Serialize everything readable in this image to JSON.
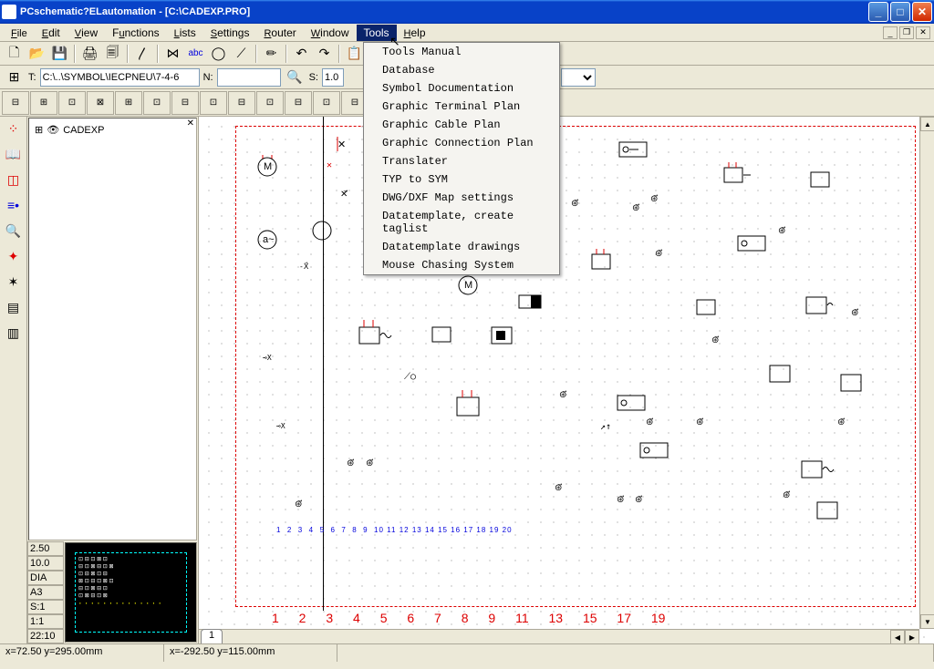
{
  "title": "PCschematic?ELautomation - [C:\\CADEXP.PRO]",
  "menu": {
    "file": "File",
    "edit": "Edit",
    "view": "View",
    "functions": "Functions",
    "lists": "Lists",
    "settings": "Settings",
    "router": "Router",
    "window": "Window",
    "tools": "Tools",
    "help": "Help"
  },
  "tools_menu": [
    "Tools Manual",
    "Database",
    "Symbol Documentation",
    "Graphic Terminal Plan",
    "Graphic Cable Plan",
    "Graphic Connection Plan",
    "Translater",
    "TYP to SYM",
    "DWG/DXF Map settings",
    "Datatemplate, create taglist",
    "Datatemplate drawings",
    "Mouse Chasing System"
  ],
  "toolbar2": {
    "t_label": "T:",
    "t_value": "C:\\..\\SYMBOL\\IECPNEU\\7-4-6",
    "n_label": "N:",
    "n_value": "",
    "s_label": "S:",
    "s_value": "1.0"
  },
  "tree": {
    "root": "CADEXP"
  },
  "statgrid": {
    "v1": "2.50",
    "v2": "10.0",
    "v3": "DIA",
    "v4": "A3",
    "v5": "S:1",
    "v6": "1:1",
    "v7": "22:10"
  },
  "status": {
    "left": "x=72.50 y=295.00mm",
    "mid": "x=-292.50 y=115.00mm"
  },
  "bottomnums": "1 2 3 4 5 6 7 8 9 11 13 15 17 19",
  "tab": "1"
}
